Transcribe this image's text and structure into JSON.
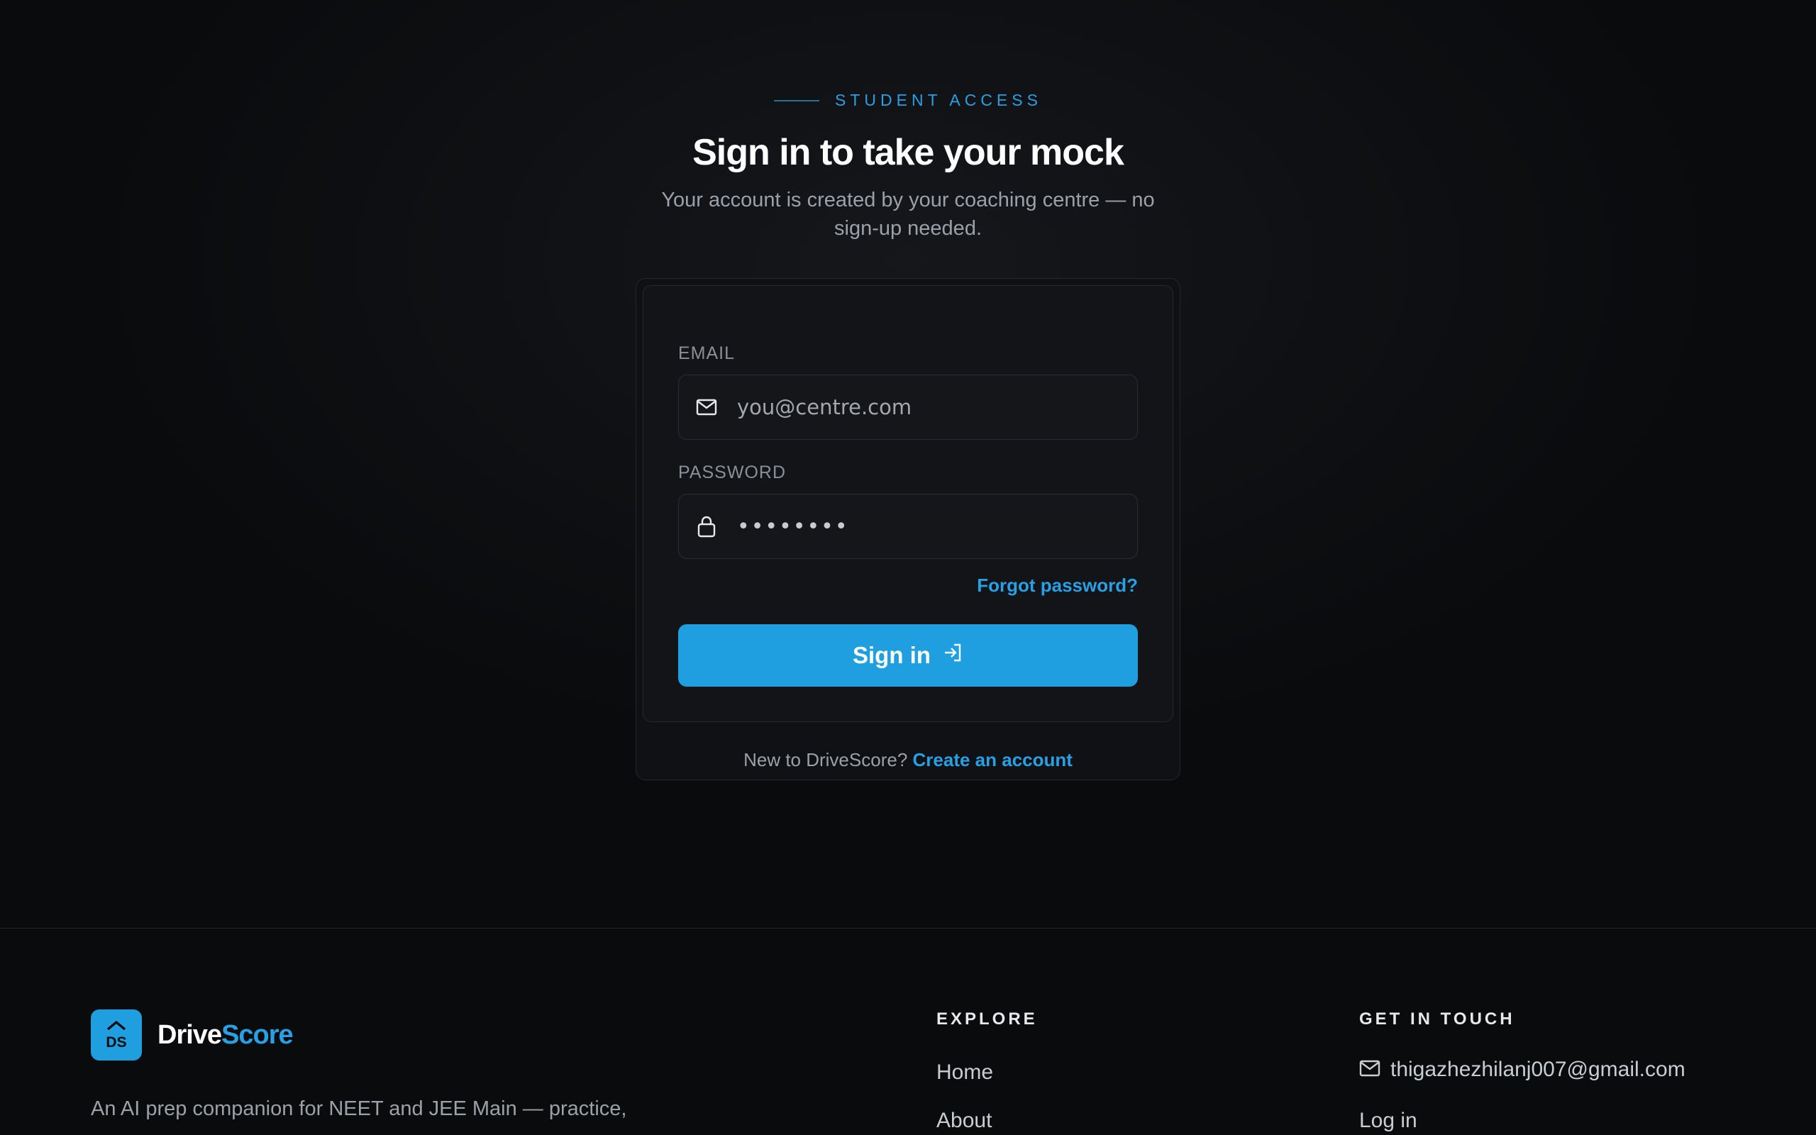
{
  "hero": {
    "eyebrow": "STUDENT ACCESS",
    "title": "Sign in to take your mock",
    "subtitle": "Your account is created by your coaching centre — no sign-up needed."
  },
  "form": {
    "email_label": "EMAIL",
    "email_placeholder": "you@centre.com",
    "email_icon": "mail-icon",
    "password_label": "PASSWORD",
    "password_value": "••••••••",
    "password_icon": "lock-icon",
    "forgot_label": "Forgot password?",
    "submit_label": "Sign in",
    "submit_icon": "login-arrow-icon",
    "new_prompt": "New to DriveScore?",
    "create_account_label": "Create an account"
  },
  "footer": {
    "logo_text": "DS",
    "brand_part1": "Drive",
    "brand_part2": "Score",
    "tagline": "An AI prep companion for NEET and JEE Main — practice,",
    "explore_heading": "EXPLORE",
    "explore_links": [
      "Home",
      "About"
    ],
    "contact_heading": "GET IN TOUCH",
    "contact_email": "thigazhezhilanj007@gmail.com",
    "contact_links": [
      "Log in"
    ]
  },
  "colors": {
    "accent": "#1f9fe0",
    "background": "#0a0b0d",
    "card": "#121417"
  }
}
